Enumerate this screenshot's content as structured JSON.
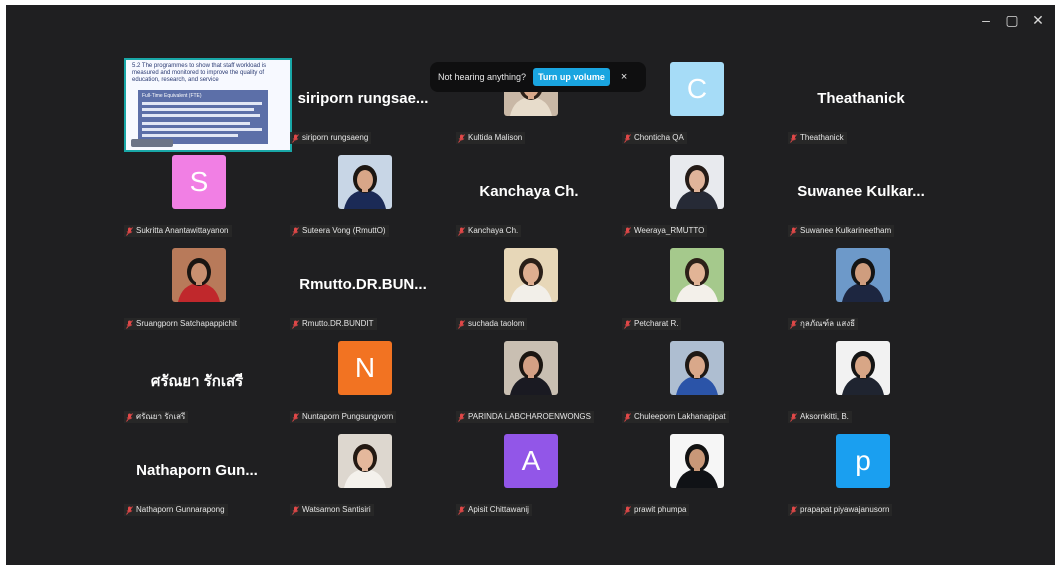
{
  "window": {
    "controls": {
      "minimize": "–",
      "restore": "▢",
      "close": "✕"
    }
  },
  "notification": {
    "text": "Not hearing anything?",
    "button": "Turn up volume",
    "close": "×"
  },
  "share_thumb": {
    "title": "5.2 The programmes to show that staff workload is measured and monitored to improve the quality of education, research, and service",
    "box_heading": "Full-Time Equivalent (FTE)",
    "label": "Sharing screen"
  },
  "participants": [
    {
      "label": "siriporn rungsaeng",
      "big": "",
      "initial": "",
      "color": "",
      "kind": "share"
    },
    {
      "label": "siriporn rungsaeng",
      "big": "siriporn  rungsae...",
      "initial": "",
      "color": "",
      "kind": "name"
    },
    {
      "label": "Kultida Malison",
      "big": "",
      "initial": "",
      "color": "",
      "kind": "photo",
      "photo": {
        "bg": "#c9b8a6",
        "shirt": "#e7dccb",
        "hair": "#2d2119",
        "skin": "#d9a98a"
      }
    },
    {
      "label": "Chonticha QA",
      "big": "",
      "initial": "C",
      "color": "#a6dcf7",
      "kind": "initial"
    },
    {
      "label": "Theathanick",
      "big": "Theathanick",
      "initial": "",
      "color": "",
      "kind": "name"
    },
    {
      "label": "Sukritta Anantawittayanon",
      "big": "",
      "initial": "S",
      "color": "#f17fe4",
      "kind": "initial"
    },
    {
      "label": "Suteera Vong (RmuttO)",
      "big": "",
      "initial": "",
      "color": "",
      "kind": "photo",
      "photo": {
        "bg": "#c8d6e6",
        "shirt": "#1b2a56",
        "hair": "#1c1612",
        "skin": "#d8a688"
      }
    },
    {
      "label": "Kanchaya Ch.",
      "big": "Kanchaya Ch.",
      "initial": "",
      "color": "",
      "kind": "name"
    },
    {
      "label": "Weeraya_RMUTTO",
      "big": "",
      "initial": "",
      "color": "",
      "kind": "photo",
      "photo": {
        "bg": "#e8eaee",
        "shirt": "#262a36",
        "hair": "#241b17",
        "skin": "#e0b49a"
      }
    },
    {
      "label": "Suwanee Kulkarineetham",
      "big": "Suwanee  Kulkar...",
      "initial": "",
      "color": "",
      "kind": "name"
    },
    {
      "label": "Sruangporn Satchapappichit",
      "big": "",
      "initial": "",
      "color": "",
      "kind": "photo",
      "photo": {
        "bg": "#b87a5a",
        "shirt": "#c0282c",
        "hair": "#1a1512",
        "skin": "#c99070"
      }
    },
    {
      "label": "Rmutto.DR.BUNDIT",
      "big": "Rmutto.DR.BUN...",
      "initial": "",
      "color": "",
      "kind": "name"
    },
    {
      "label": "suchada taolom",
      "big": "",
      "initial": "",
      "color": "",
      "kind": "photo",
      "photo": {
        "bg": "#e7d7b8",
        "shirt": "#f2efe9",
        "hair": "#2a1f18",
        "skin": "#deae90"
      }
    },
    {
      "label": "Petcharat R.",
      "big": "",
      "initial": "",
      "color": "",
      "kind": "photo",
      "photo": {
        "bg": "#a5c98c",
        "shirt": "#f3f0ea",
        "hair": "#2c2018",
        "skin": "#e2b496"
      }
    },
    {
      "label": "กุลภัณฑ์ล แสงธี",
      "big": "",
      "initial": "",
      "color": "",
      "kind": "photo",
      "photo": {
        "bg": "#6d99c9",
        "shirt": "#1d2640",
        "hair": "#141414",
        "skin": "#cf9d7e"
      }
    },
    {
      "label": "ศรัณยา รักเสรี",
      "big": "ศรัณยา  รักเสรี",
      "initial": "",
      "color": "",
      "kind": "name"
    },
    {
      "label": "Nuntaporn Pungsungvorn",
      "big": "",
      "initial": "N",
      "color": "#f27322",
      "kind": "initial"
    },
    {
      "label": "PARINDA LABCHAROENWONGS",
      "big": "",
      "initial": "",
      "color": "",
      "kind": "photo",
      "photo": {
        "bg": "#c9bfb2",
        "shirt": "#1a1a22",
        "hair": "#1b1511",
        "skin": "#d4a084"
      }
    },
    {
      "label": "Chuleeporn Lakhanapipat",
      "big": "",
      "initial": "",
      "color": "",
      "kind": "photo",
      "photo": {
        "bg": "#aebed1",
        "shirt": "#2b54a8",
        "hair": "#1e1814",
        "skin": "#d9a88a"
      }
    },
    {
      "label": "Aksornkitti, B.",
      "big": "",
      "initial": "",
      "color": "",
      "kind": "photo",
      "photo": {
        "bg": "#f2f2f2",
        "shirt": "#1f2430",
        "hair": "#151515",
        "skin": "#d8a686"
      }
    },
    {
      "label": "Nathaporn Gunnarapong",
      "big": "Nathaporn  Gun...",
      "initial": "",
      "color": "",
      "kind": "name"
    },
    {
      "label": "Watsamon Santisiri",
      "big": "",
      "initial": "",
      "color": "",
      "kind": "photo",
      "photo": {
        "bg": "#ddd7cf",
        "shirt": "#f4f1ec",
        "hair": "#231913",
        "skin": "#e4b89c"
      }
    },
    {
      "label": "Apisit Chittawanij",
      "big": "",
      "initial": "A",
      "color": "#9256e8",
      "kind": "initial"
    },
    {
      "label": "prawit phumpa",
      "big": "",
      "initial": "",
      "color": "",
      "kind": "photo",
      "photo": {
        "bg": "#f6f6f6",
        "shirt": "#101216",
        "hair": "#121212",
        "skin": "#c99878"
      }
    },
    {
      "label": "prapapat piyawajanusorn",
      "big": "",
      "initial": "p",
      "color": "#1a9ff0",
      "kind": "initial"
    }
  ]
}
